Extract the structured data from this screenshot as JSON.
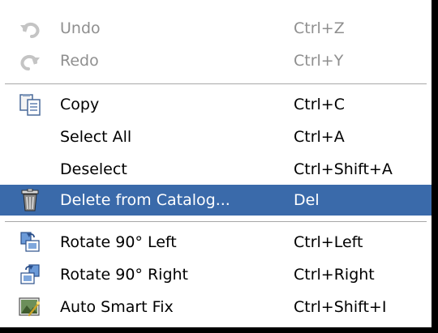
{
  "menu": {
    "items": [
      {
        "label": "Undo",
        "shortcut": "Ctrl+Z",
        "icon": "undo-icon",
        "enabled": false
      },
      {
        "label": "Redo",
        "shortcut": "Ctrl+Y",
        "icon": "redo-icon",
        "enabled": false
      },
      {
        "label": "Copy",
        "shortcut": "Ctrl+C",
        "icon": "copy-icon",
        "enabled": true
      },
      {
        "label": "Select All",
        "shortcut": "Ctrl+A",
        "icon": "",
        "enabled": true
      },
      {
        "label": "Deselect",
        "shortcut": "Ctrl+Shift+A",
        "icon": "",
        "enabled": true
      },
      {
        "label": "Delete from Catalog...",
        "shortcut": "Del",
        "icon": "trash-icon",
        "enabled": true,
        "selected": true
      },
      {
        "label": "Rotate 90° Left",
        "shortcut": "Ctrl+Left",
        "icon": "rotate-left-icon",
        "enabled": true
      },
      {
        "label": "Rotate 90° Right",
        "shortcut": "Ctrl+Right",
        "icon": "rotate-right-icon",
        "enabled": true
      },
      {
        "label": "Auto Smart Fix",
        "shortcut": "Ctrl+Shift+I",
        "icon": "auto-smart-fix-icon",
        "enabled": true
      }
    ]
  },
  "colors": {
    "highlight": "#3a6aaa",
    "disabled_text": "#8f8f8f",
    "separator": "#a8a8a8"
  }
}
